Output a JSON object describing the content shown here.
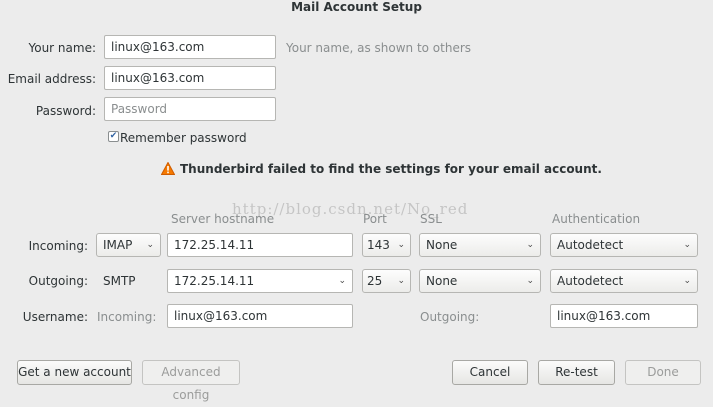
{
  "window": {
    "title": "Mail Account Setup"
  },
  "form": {
    "name_label": "Your name:",
    "name_value": "linux@163.com",
    "name_hint": "Your name, as shown to others",
    "email_label": "Email address:",
    "email_value": "linux@163.com",
    "password_label": "Password:",
    "password_placeholder": "Password",
    "remember_label": "Remember password",
    "remember_checked": true
  },
  "warning": {
    "icon": "warning-triangle-icon",
    "color": "#f57900",
    "text": "Thunderbird failed to find the settings for your email account."
  },
  "watermark": "http://blog.csdn.net/No_red",
  "server": {
    "headers": {
      "hostname": "Server hostname",
      "port": "Port",
      "ssl": "SSL",
      "auth": "Authentication"
    },
    "incoming": {
      "label": "Incoming:",
      "protocol": "IMAP",
      "hostname": "172.25.14.11",
      "port": "143",
      "ssl": "None",
      "auth": "Autodetect"
    },
    "outgoing": {
      "label": "Outgoing:",
      "protocol": "SMTP",
      "hostname": "172.25.14.11",
      "port": "25",
      "ssl": "None",
      "auth": "Autodetect"
    },
    "username": {
      "label": "Username:",
      "incoming_label": "Incoming:",
      "incoming_value": "linux@163.com",
      "outgoing_label": "Outgoing:",
      "outgoing_value": "linux@163.com"
    }
  },
  "buttons": {
    "get_account": "Get a new account",
    "advanced": "Advanced config",
    "cancel": "Cancel",
    "retest": "Re-test",
    "done": "Done"
  }
}
